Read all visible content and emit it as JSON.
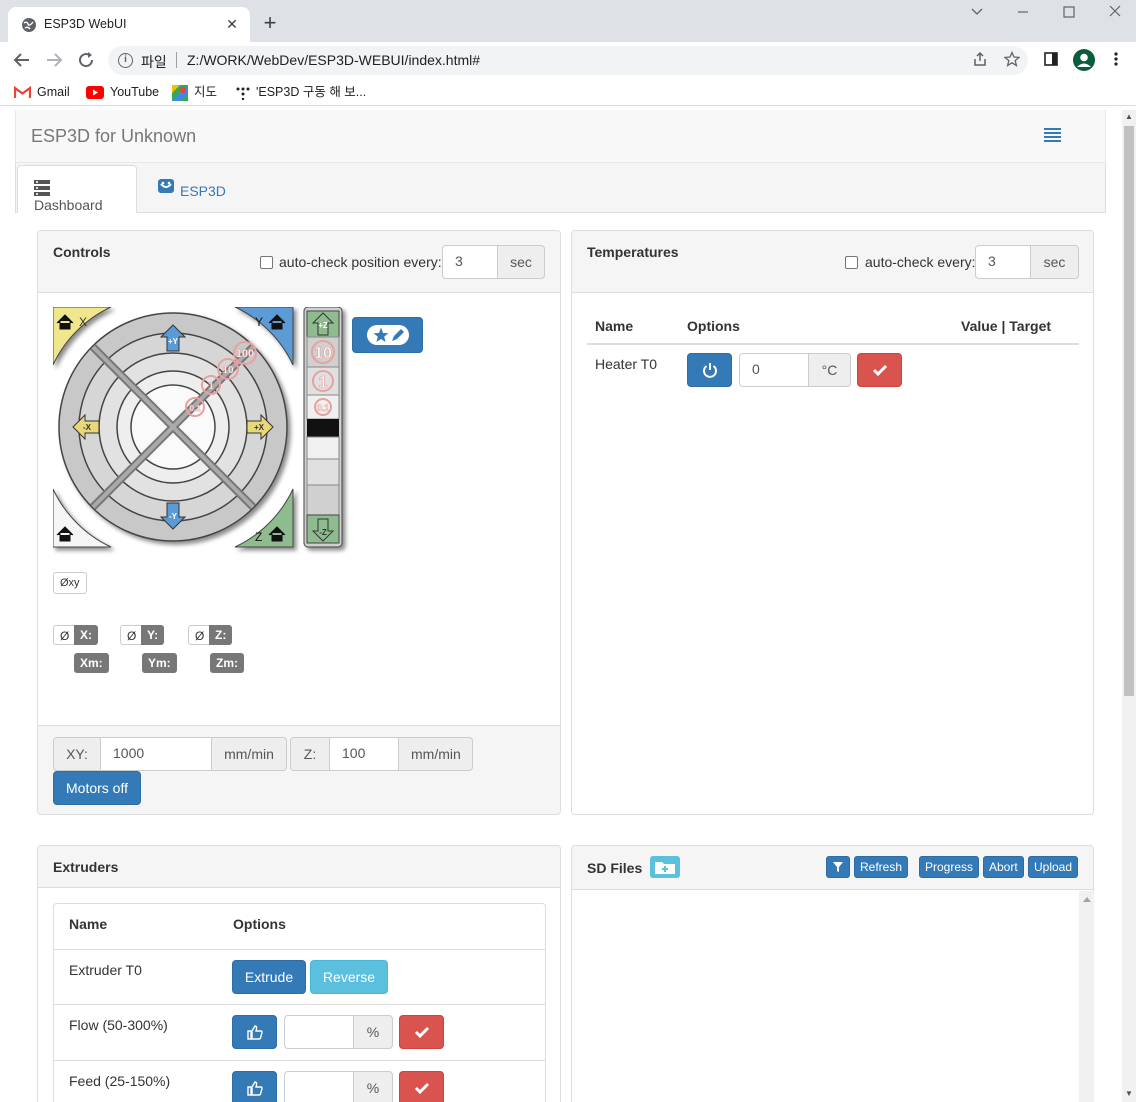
{
  "browser": {
    "tab_title": "ESP3D WebUI",
    "new_tab": "+",
    "close_tab": "✕",
    "address_scheme": "파일",
    "address_url": "Z:/WORK/WebDev/ESP3D-WEBUI/index.html#",
    "bookmarks": [
      {
        "label": "Gmail",
        "icon": "gmail-icon"
      },
      {
        "label": "YouTube",
        "icon": "youtube-icon"
      },
      {
        "label": "지도",
        "icon": "maps-icon"
      },
      {
        "label": "'ESP3D 구동 해 보...",
        "icon": "dots-icon"
      }
    ]
  },
  "app": {
    "brand": "ESP3D for Unknown",
    "tabs": [
      {
        "label": "Dashboard",
        "icon": "dashboard-icon"
      },
      {
        "label": "ESP3D",
        "icon": "esp3d-icon"
      }
    ]
  },
  "controls": {
    "title": "Controls",
    "autocheck_label": "auto-check position every:",
    "autocheck_value": "3",
    "autocheck_unit": "sec",
    "jog": {
      "home_x": "X",
      "home_y": "Y",
      "home_z": "Z",
      "plus_y": "+Y",
      "minus_y": "-Y",
      "plus_x": "+X",
      "minus_x": "-X",
      "plus_z": "+Z",
      "minus_z": "-Z",
      "ring_10": "10",
      "ring_1": "1",
      "ring_01": "0.1",
      "ring_100": "100",
      "z_10": "10",
      "z_1": "1",
      "z_01": "0.1"
    },
    "zero_xy": "Øxy",
    "zero_symbol": "Ø",
    "positions": [
      {
        "axis": "X:",
        "machine": "Xm:"
      },
      {
        "axis": "Y:",
        "machine": "Ym:"
      },
      {
        "axis": "Z:",
        "machine": "Zm:"
      }
    ],
    "feed": {
      "xy_label": "XY:",
      "xy_value": "1000",
      "xy_unit": "mm/min",
      "z_label": "Z:",
      "z_value": "100",
      "z_unit": "mm/min"
    },
    "motors_off": "Motors off"
  },
  "temperatures": {
    "title": "Temperatures",
    "autocheck_label": "auto-check every:",
    "autocheck_value": "3",
    "autocheck_unit": "sec",
    "headers": {
      "name": "Name",
      "options": "Options",
      "value": "Value | Target"
    },
    "rows": [
      {
        "name": "Heater T0",
        "value": "0",
        "unit": "°C"
      }
    ]
  },
  "extruders": {
    "title": "Extruders",
    "headers": {
      "name": "Name",
      "options": "Options"
    },
    "rows": [
      {
        "name": "Extruder T0",
        "extrude": "Extrude",
        "reverse": "Reverse"
      },
      {
        "name": "Flow (50-300%)",
        "value": "",
        "unit": "%"
      },
      {
        "name": "Feed (25-150%)",
        "value": "",
        "unit": "%"
      }
    ]
  },
  "sdfiles": {
    "title": "SD Files",
    "buttons": {
      "refresh": "Refresh",
      "progress": "Progress",
      "abort": "Abort",
      "upload": "Upload"
    }
  },
  "colors": {
    "primary": "#337ab7",
    "danger": "#d9534f",
    "info": "#5bc0de",
    "home_x": "#f0e68c",
    "home_y": "#4a90d9",
    "home_z": "#8fbc8f"
  }
}
